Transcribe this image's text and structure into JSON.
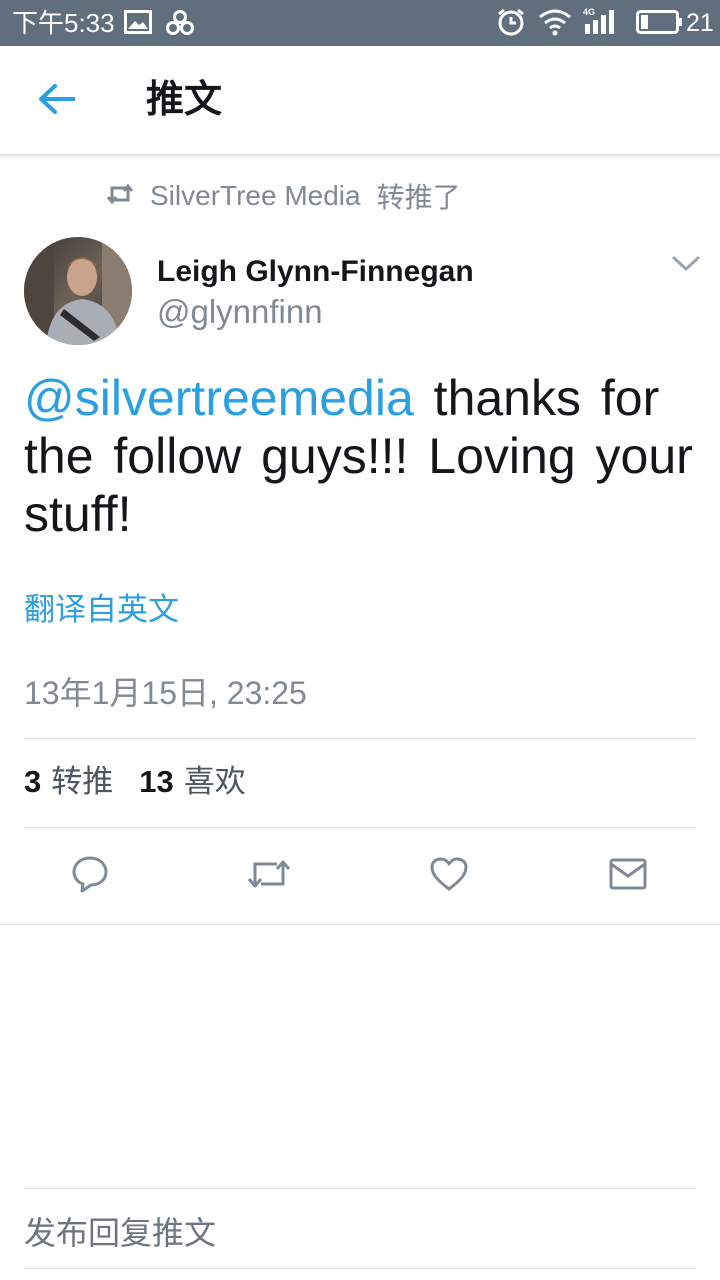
{
  "status_bar": {
    "time": "下午5:33",
    "battery_level": "21",
    "network": "4G",
    "icons": [
      "image-icon",
      "pinwheel-icon",
      "alarm-icon",
      "wifi-icon",
      "signal-icon",
      "battery-icon"
    ]
  },
  "app_bar": {
    "back_icon": "arrow-left-icon",
    "title": "推文"
  },
  "retweet_context": {
    "icon": "retweet-icon",
    "user": "SilverTree Media",
    "action": "转推了"
  },
  "tweet": {
    "author_name": "Leigh Glynn-Finnegan",
    "author_handle": "@glynnfinn",
    "mention": "@silvertreemedia",
    "text": " thanks for the follow guys!!! Loving your stuff!",
    "translate_label": "翻译自英文",
    "timestamp": "13年1月15日, 23:25",
    "retweets_count": "3",
    "retweets_label": "转推",
    "likes_count": "13",
    "likes_label": "喜欢"
  },
  "actions": [
    "reply-icon",
    "retweet-icon",
    "like-icon",
    "message-icon"
  ],
  "reply_box": {
    "placeholder": "发布回复推文"
  },
  "colors": {
    "status_bar_bg": "#5f6f7d",
    "accent": "#2b9fe0",
    "secondary_text": "#7f8a94",
    "divider": "#dfe3e7"
  }
}
